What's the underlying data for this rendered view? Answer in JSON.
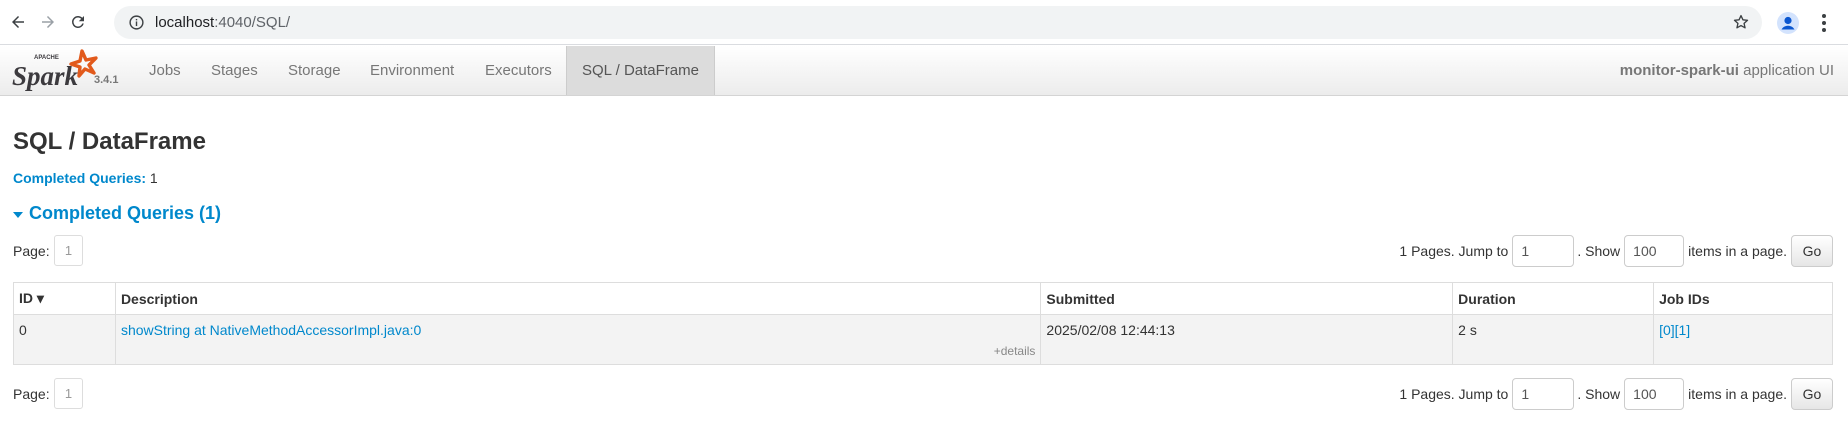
{
  "browser": {
    "url_host": "localhost",
    "url_path": ":4040/SQL/",
    "back_icon": "arrow-left-icon",
    "forward_icon": "arrow-right-icon",
    "reload_icon": "reload-icon"
  },
  "navbar": {
    "version": "3.4.1",
    "items": [
      {
        "label": "Jobs",
        "active": false
      },
      {
        "label": "Stages",
        "active": false
      },
      {
        "label": "Storage",
        "active": false
      },
      {
        "label": "Environment",
        "active": false
      },
      {
        "label": "Executors",
        "active": false
      },
      {
        "label": "SQL / DataFrame",
        "active": true
      }
    ],
    "app_name": "monitor-spark-ui",
    "app_suffix": " application UI"
  },
  "page": {
    "title": "SQL / DataFrame",
    "summary_label": "Completed Queries:",
    "summary_value": "1",
    "section_title": "Completed Queries (1)"
  },
  "pager": {
    "page_label": "Page:",
    "current_page": "1",
    "pages_text": "1 Pages. Jump to",
    "jump_value": "1",
    "show_text": ". Show",
    "show_value": "100",
    "items_text": "items in a page.",
    "go_label": "Go"
  },
  "table": {
    "headers": [
      "ID ▾",
      "Description",
      "Submitted",
      "Duration",
      "Job IDs"
    ],
    "rows": [
      {
        "id": "0",
        "description": "showString at NativeMethodAccessorImpl.java:0",
        "details": "+details",
        "submitted": "2025/02/08 12:44:13",
        "duration": "2 s",
        "job_ids": "[0][1]"
      }
    ]
  },
  "colors": {
    "link": "#0088cc",
    "active_tab": "#dcdcdc"
  }
}
